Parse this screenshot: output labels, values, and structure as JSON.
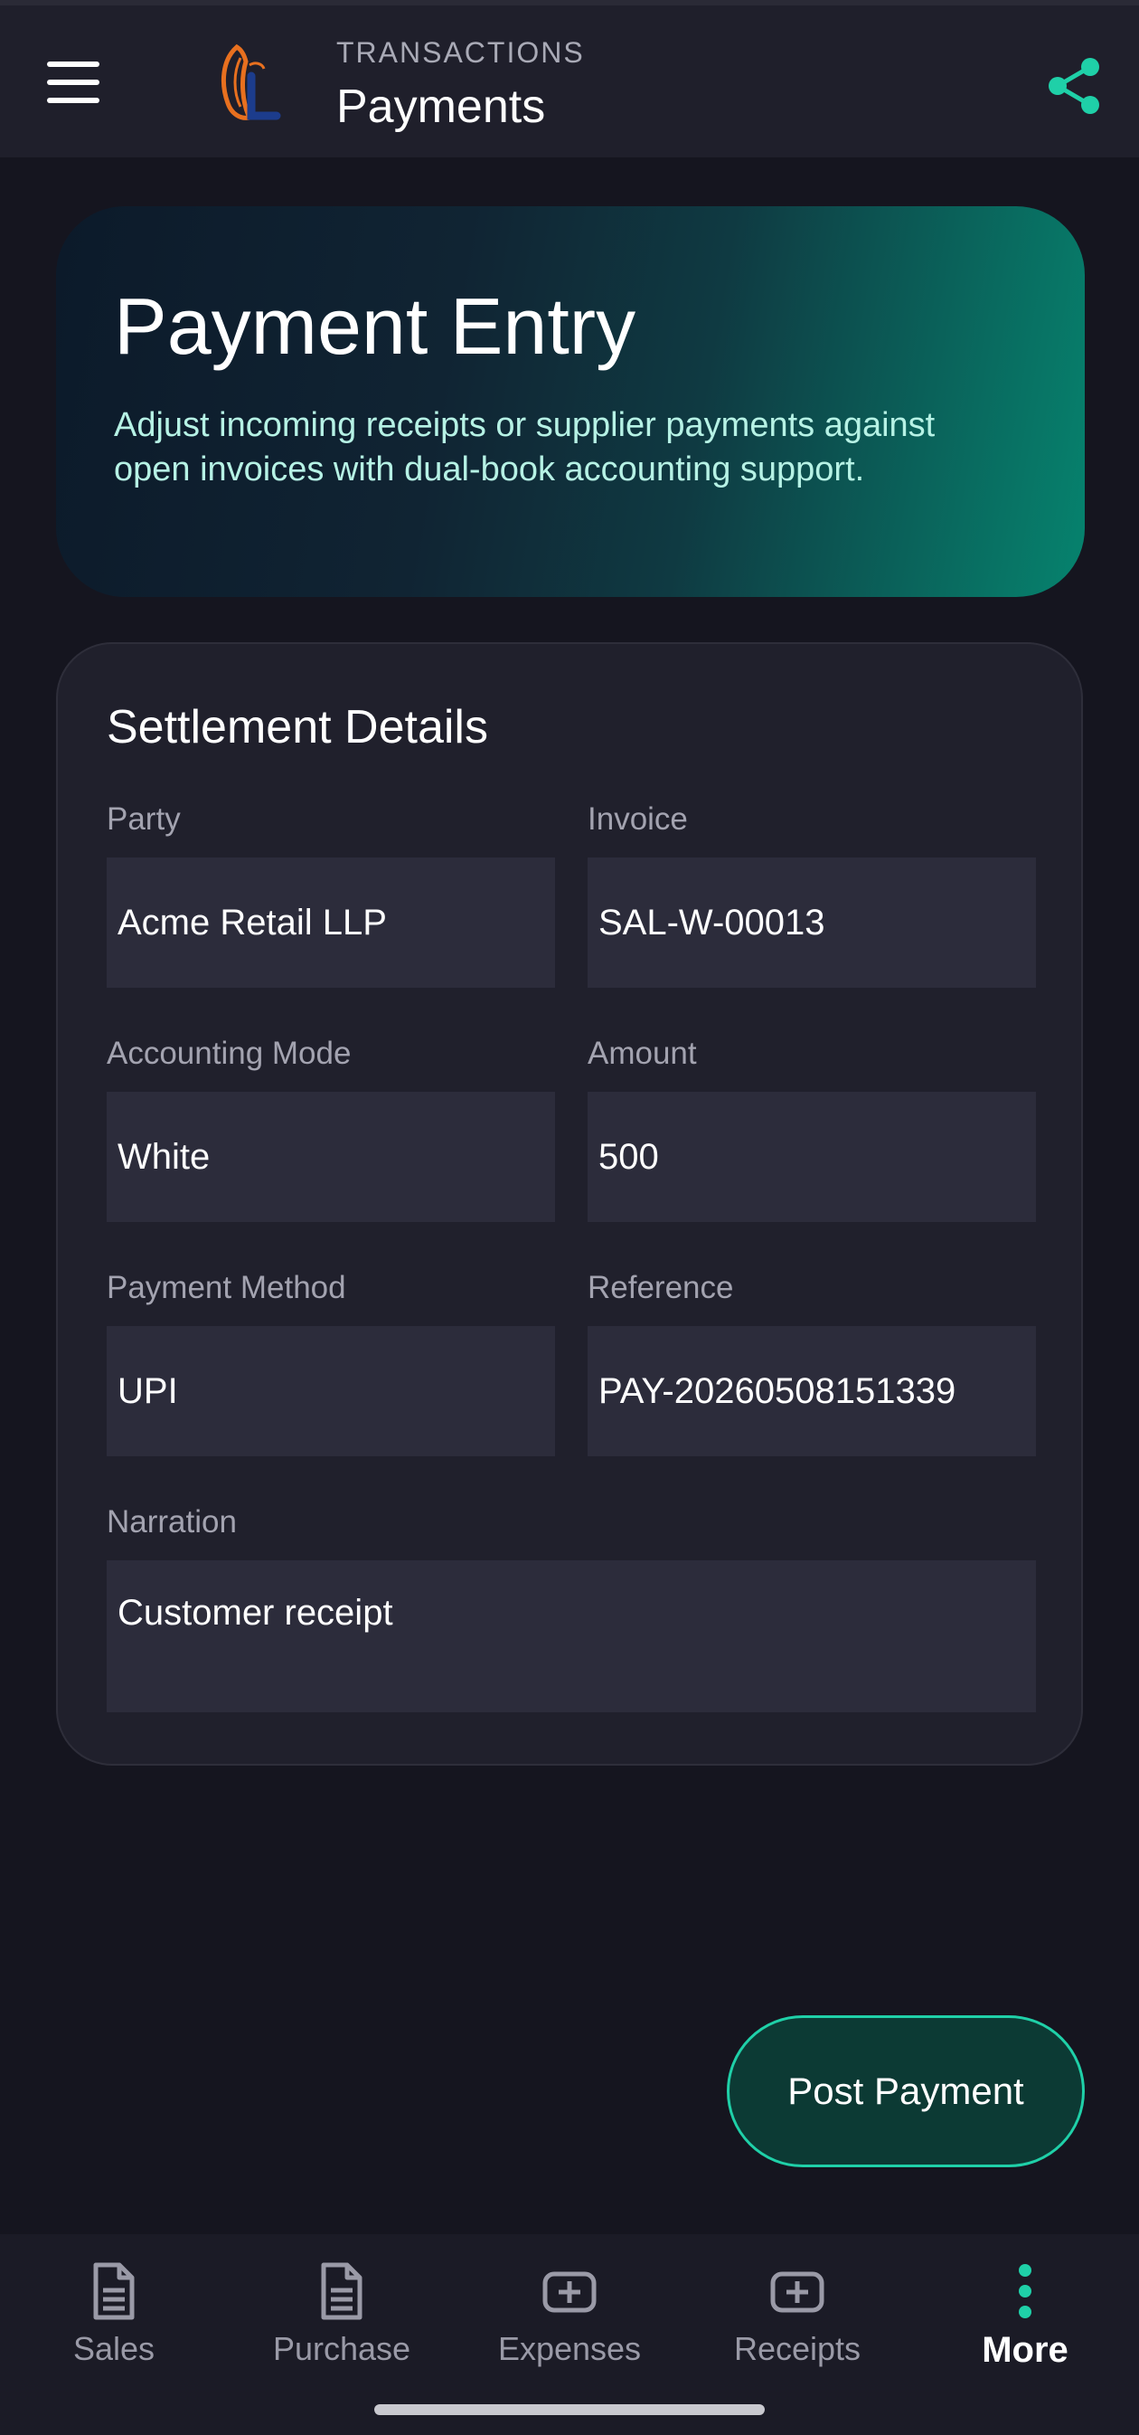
{
  "appbar": {
    "subtitle": "TRANSACTIONS",
    "title": "Payments",
    "menu_icon": "hamburger-menu-icon",
    "share_icon": "share-icon",
    "accent": "#1fd0a8"
  },
  "hero": {
    "title": "Payment Entry",
    "description": "Adjust incoming receipts or supplier payments against open invoices with dual-book accounting support."
  },
  "settlement": {
    "title": "Settlement Details",
    "fields": {
      "party": {
        "label": "Party",
        "value": "Acme Retail LLP"
      },
      "invoice": {
        "label": "Invoice",
        "value": "SAL-W-00013"
      },
      "accounting_mode": {
        "label": "Accounting Mode",
        "value": "White"
      },
      "amount": {
        "label": "Amount",
        "value": "500"
      },
      "payment_method": {
        "label": "Payment Method",
        "value": "UPI"
      },
      "reference": {
        "label": "Reference",
        "value": "PAY-20260508151339"
      },
      "narration": {
        "label": "Narration",
        "value": "Customer receipt"
      }
    }
  },
  "actions": {
    "post_payment": "Post Payment"
  },
  "bottom_nav": {
    "items": [
      {
        "label": "Sales",
        "icon": "document-icon",
        "active": false
      },
      {
        "label": "Purchase",
        "icon": "document-icon",
        "active": false
      },
      {
        "label": "Expenses",
        "icon": "plus-box-icon",
        "active": false
      },
      {
        "label": "Receipts",
        "icon": "plus-box-icon",
        "active": false
      },
      {
        "label": "More",
        "icon": "more-vertical-icon",
        "active": true
      }
    ]
  }
}
